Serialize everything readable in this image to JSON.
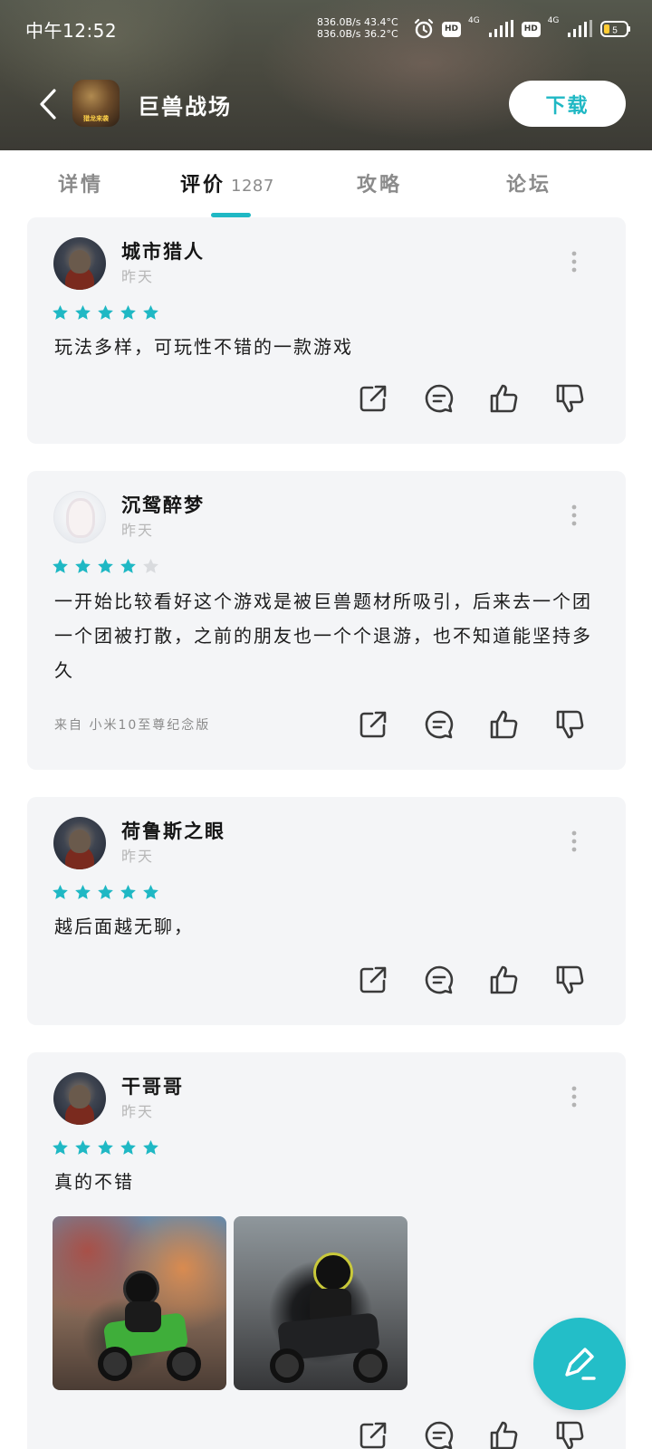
{
  "status_bar": {
    "time": "中午12:52",
    "net_speed_up": "836.0B/s 43.4°C",
    "net_speed_down": "836.0B/s 36.2°C",
    "hd_label": "HD",
    "net_type_1": "4G",
    "net_type_2": "4G",
    "battery_level": "5"
  },
  "header": {
    "app_title": "巨兽战场",
    "app_icon_text": "猎龙来袭",
    "download_label": "下载"
  },
  "tabs": {
    "details": "详情",
    "reviews": "评价",
    "reviews_count": "1287",
    "guides": "攻略",
    "forum": "论坛"
  },
  "colors": {
    "accent": "#1fb8c4",
    "star_active": "#1fb8c4",
    "star_inactive": "#d9dbde",
    "card_bg": "#f4f5f7"
  },
  "reviews": [
    {
      "username": "城市猎人",
      "time": "昨天",
      "rating": 5,
      "text": "玩法多样，可玩性不错的一款游戏"
    },
    {
      "username": "沉鸳醉梦",
      "time": "昨天",
      "rating": 4,
      "text": "一开始比较看好这个游戏是被巨兽题材所吸引，后来去一个团一个团被打散，之前的朋友也一个个退游，也不知道能坚持多久",
      "device": "来自 小米10至尊纪念版"
    },
    {
      "username": "荷鲁斯之眼",
      "time": "昨天",
      "rating": 5,
      "text": "越后面越无聊，"
    },
    {
      "username": "干哥哥",
      "time": "昨天",
      "rating": 5,
      "text": "真的不错"
    }
  ],
  "icons": {
    "share": "share-icon",
    "comment": "comment-icon",
    "like": "thumbs-up-icon",
    "dislike": "thumbs-down-icon",
    "more": "more-vertical-icon",
    "compose": "pen-icon"
  }
}
